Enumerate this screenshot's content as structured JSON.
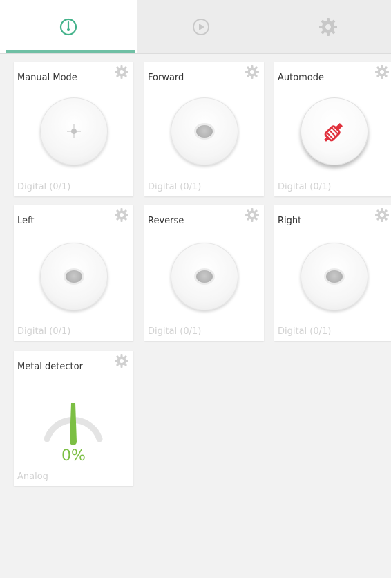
{
  "tabs": [
    {
      "name": "dashboard",
      "icon": "gauge-icon",
      "active": true
    },
    {
      "name": "play",
      "icon": "play-icon",
      "active": false
    },
    {
      "name": "settings",
      "icon": "settings-icon",
      "active": false
    }
  ],
  "colors": {
    "accent": "#6fbfa4",
    "gauge": "#7cbf44",
    "automode_icon": "#e0303c"
  },
  "widgets": [
    {
      "title": "Manual Mode",
      "footer": "Digital (0/1)",
      "type": "button",
      "icon": "crosshair-icon"
    },
    {
      "title": "Forward",
      "footer": "Digital (0/1)",
      "type": "button",
      "icon": "dot"
    },
    {
      "title": "Automode",
      "footer": "Digital (0/1)",
      "type": "button",
      "icon": "screwdriver-icon"
    },
    {
      "title": "Left",
      "footer": "Digital (0/1)",
      "type": "button",
      "icon": "dot"
    },
    {
      "title": "Reverse",
      "footer": "Digital (0/1)",
      "type": "button",
      "icon": "dot"
    },
    {
      "title": "Right",
      "footer": "Digital (0/1)",
      "type": "button",
      "icon": "dot"
    },
    {
      "title": "Metal detector",
      "footer": "Analog",
      "type": "gauge",
      "value": "0%",
      "level": 0
    }
  ]
}
